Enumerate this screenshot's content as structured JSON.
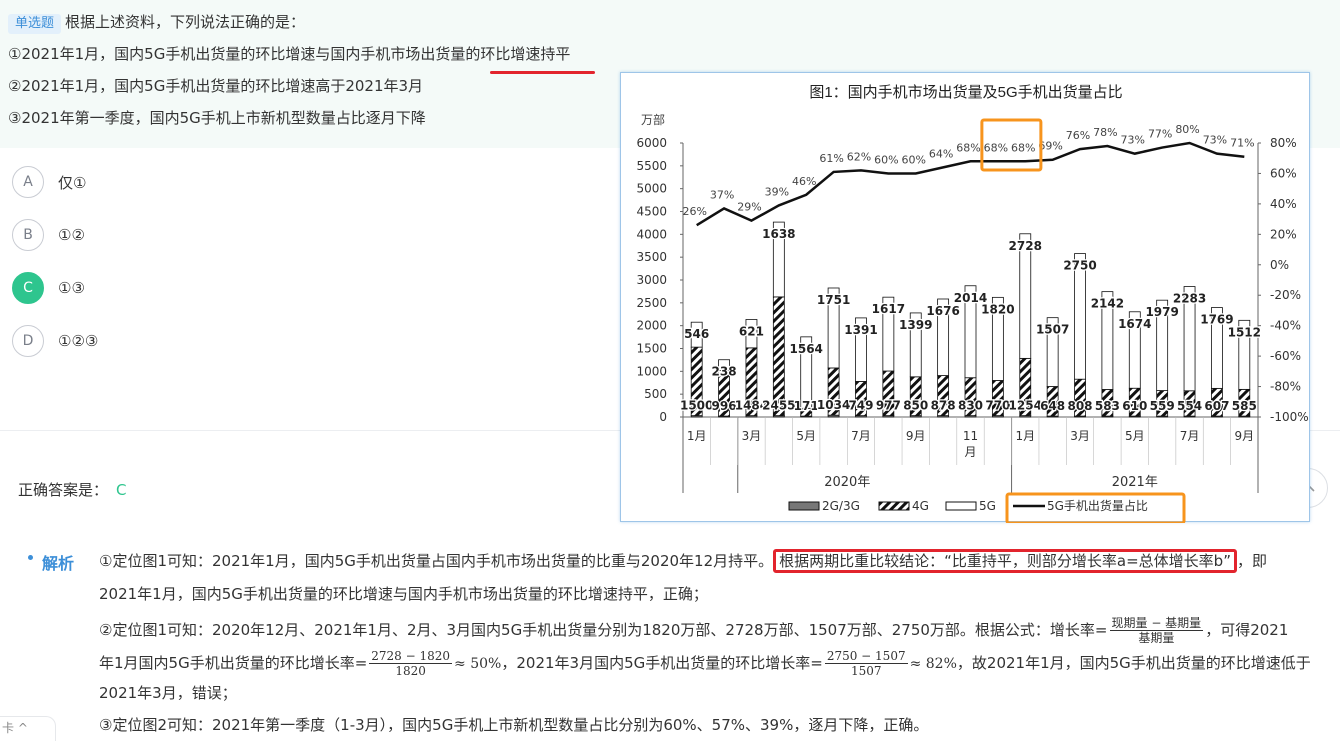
{
  "question": {
    "tag": "单选题",
    "stem": "根据上述资料，下列说法正确的是：",
    "statements": [
      "①2021年1月，国内5G手机出货量的环比增速与国内手机市场出货量的环比增速持平",
      "②2021年1月，国内5G手机出货量的环比增速高于2021年3月",
      "③2021年第一季度，国内5G手机上市新机型数量占比逐月下降"
    ]
  },
  "options": [
    {
      "letter": "A",
      "text": "仅①",
      "selected": false
    },
    {
      "letter": "B",
      "text": "①②",
      "selected": false
    },
    {
      "letter": "C",
      "text": "①③",
      "selected": true
    },
    {
      "letter": "D",
      "text": "①②③",
      "selected": false
    }
  ],
  "answer": {
    "label": "正确答案是：",
    "value": "C"
  },
  "collapse_icon": "chevron-up-icon",
  "analysis": {
    "label": "解析",
    "p1_pre": "①定位图1可知：2021年1月，国内5G手机出货量占国内手机市场出货量的比重与2020年12月持平。",
    "p1_box": "根据两期比重比较结论：“比重持平，则部分增长率a=总体增长率b”",
    "p1_post": "，即",
    "p1_line2": "2021年1月，国内5G手机出货量的环比增速与国内手机市场出货量的环比增速持平，正确；",
    "p2_line1": "②定位图1可知：2020年12月、2021年1月、2月、3月国内5G手机出货量分别为1820万部、2728万部、1507万部、2750万部。根据公式：增长率=",
    "formula_num": "现期量 − 基期量",
    "formula_den": "基期量",
    "p2_line1_end": "，可得2021",
    "p2_line2_a": "年1月国内5G手机出货量的环比增长率=",
    "f1_num": "2728 − 1820",
    "f1_den": "1820",
    "f1_result": "≈ 50%",
    "p2_line2_b": "，2021年3月国内5G手机出货量的环比增长率=",
    "f2_num": "2750 − 1507",
    "f2_den": "1507",
    "f2_result": "≈ 82%",
    "p2_line2_c": "，故2021年1月，国内5G手机出货量的环比增速低于",
    "p2_line3": "2021年3月，错误；",
    "p3": "③定位图2可知：2021年第一季度（1-3月），国内5G手机上市新机型数量占比分别为60%、57%、39%，逐月下降，正确。"
  },
  "bottom_tab": {
    "label": "卡 ^"
  },
  "chart_data": {
    "type": "bar",
    "title": "图1：国内手机市场出货量及5G手机出货量占比",
    "y_unit": "万部",
    "ylim": [
      0,
      6000
    ],
    "yticks": [
      0,
      500,
      1000,
      1500,
      2000,
      2500,
      3000,
      3500,
      4000,
      4500,
      5000,
      5500,
      6000
    ],
    "y2lim": [
      -100,
      80
    ],
    "y2ticks": [
      "80%",
      "60%",
      "40%",
      "20%",
      "0%",
      "-20%",
      "-40%",
      "-60%",
      "-80%",
      "-100%"
    ],
    "x_month_labels": [
      "1月",
      "3月",
      "5月",
      "7月",
      "9月",
      "11\n月",
      "1月",
      "3月",
      "5月",
      "7月",
      "9月"
    ],
    "year_labels": [
      "2020年",
      "2021年"
    ],
    "months": 21,
    "label_4g": [
      "1500",
      "996",
      "1484",
      "2455",
      "171",
      "1034",
      "749",
      "977",
      "850",
      "878",
      "830",
      "770",
      "1254",
      "648",
      "808",
      "583",
      "610",
      "559",
      "554",
      "607",
      "585"
    ],
    "label_5g": [
      "546",
      "238",
      "621",
      "1638",
      "1564",
      "1751",
      "1391",
      "1617",
      "1399",
      "1676",
      "2014",
      "1820",
      "2728",
      "1507",
      "2750",
      "2142",
      "1674",
      "1979",
      "2283",
      "1769",
      "1512"
    ],
    "series": [
      {
        "name": "2G/3G",
        "values": [
          30,
          20,
          30,
          30,
          20,
          40,
          30,
          30,
          30,
          30,
          30,
          30,
          30,
          20,
          20,
          20,
          20,
          20,
          20,
          20,
          20
        ]
      },
      {
        "name": "4G",
        "values": [
          1500,
          996,
          1484,
          2600,
          171,
          1034,
          749,
          977,
          850,
          878,
          830,
          770,
          1254,
          648,
          808,
          583,
          610,
          559,
          554,
          607,
          585
        ]
      },
      {
        "name": "5G",
        "values": [
          546,
          238,
          621,
          1638,
          1564,
          1751,
          1391,
          1617,
          1399,
          1676,
          2014,
          1820,
          2728,
          1507,
          2750,
          2142,
          1674,
          1979,
          2283,
          1769,
          1512
        ]
      },
      {
        "name": "5G手机出货量占比",
        "values": [
          26,
          37,
          29,
          39,
          46,
          61,
          62,
          60,
          60,
          64,
          68,
          68,
          68,
          69,
          76,
          78,
          73,
          77,
          80,
          73,
          71
        ]
      }
    ],
    "highlight_boxes_color": "#f7941d"
  }
}
